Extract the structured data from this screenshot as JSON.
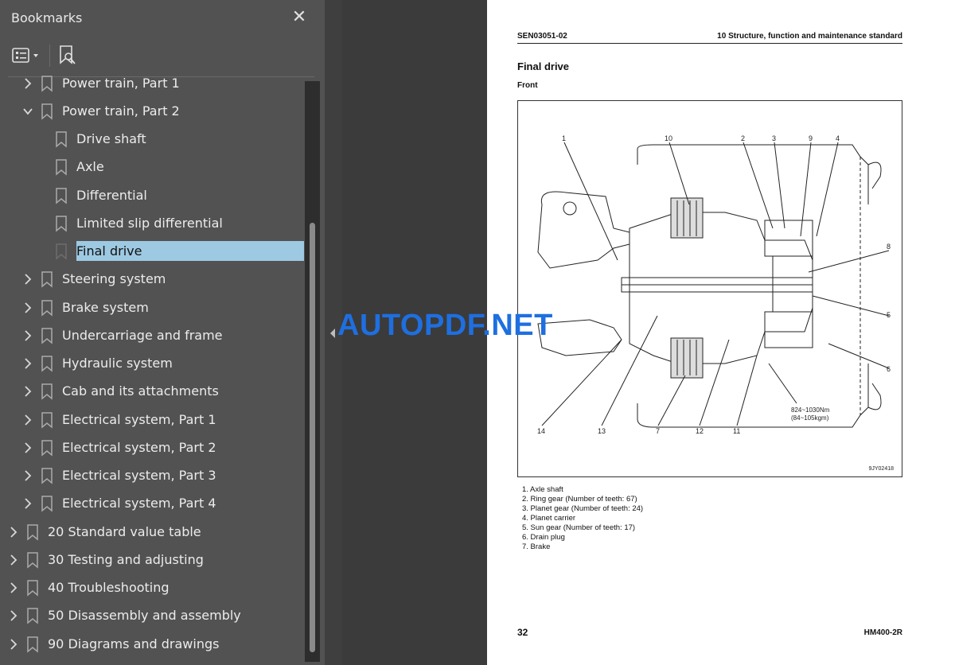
{
  "panel": {
    "title": "Bookmarks",
    "close_glyph": "✕",
    "icons": {
      "close": "close-icon",
      "options": "list-options-icon",
      "find": "bookmark-search-icon"
    }
  },
  "tree": [
    {
      "label": "Power train, Part 1",
      "level": 1,
      "state": "collapsed"
    },
    {
      "label": "Power train, Part 2",
      "level": 1,
      "state": "expanded"
    },
    {
      "label": "Drive shaft",
      "level": 2,
      "state": "leaf"
    },
    {
      "label": "Axle",
      "level": 2,
      "state": "leaf"
    },
    {
      "label": "Differential",
      "level": 2,
      "state": "leaf"
    },
    {
      "label": "Limited slip differential",
      "level": 2,
      "state": "leaf"
    },
    {
      "label": "Final drive",
      "level": 2,
      "state": "leaf",
      "selected": true
    },
    {
      "label": "Steering system",
      "level": 1,
      "state": "collapsed"
    },
    {
      "label": "Brake system",
      "level": 1,
      "state": "collapsed"
    },
    {
      "label": "Undercarriage and frame",
      "level": 1,
      "state": "collapsed"
    },
    {
      "label": "Hydraulic system",
      "level": 1,
      "state": "collapsed"
    },
    {
      "label": "Cab and its attachments",
      "level": 1,
      "state": "collapsed"
    },
    {
      "label": "Electrical system, Part 1",
      "level": 1,
      "state": "collapsed"
    },
    {
      "label": "Electrical system, Part 2",
      "level": 1,
      "state": "collapsed"
    },
    {
      "label": "Electrical system, Part 3",
      "level": 1,
      "state": "collapsed"
    },
    {
      "label": "Electrical system, Part 4",
      "level": 1,
      "state": "collapsed"
    },
    {
      "label": "20 Standard value table",
      "level": 0,
      "state": "collapsed"
    },
    {
      "label": "30 Testing and adjusting",
      "level": 0,
      "state": "collapsed"
    },
    {
      "label": "40 Troubleshooting",
      "level": 0,
      "state": "collapsed"
    },
    {
      "label": "50 Disassembly and assembly",
      "level": 0,
      "state": "collapsed"
    },
    {
      "label": "90 Diagrams and drawings",
      "level": 0,
      "state": "collapsed"
    }
  ],
  "document": {
    "header_code": "SEN03051-02",
    "header_section": "10 Structure, function and maintenance standard",
    "title": "Final drive",
    "subtitle": "Front",
    "figure_code": "9JY02418",
    "torque_label_1": "824~1030Nm",
    "torque_label_2": "(84~105kgm)",
    "callouts": [
      "1",
      "10",
      "2",
      "3",
      "9",
      "4",
      "8",
      "5",
      "6",
      "14",
      "13",
      "7",
      "12",
      "11"
    ],
    "parts": [
      "1. Axle shaft",
      "2. Ring gear (Number of teeth: 67)",
      "3. Planet gear (Number of teeth: 24)",
      "4. Planet carrier",
      "5. Sun gear (Number of teeth: 17)",
      "6. Drain plug",
      "7. Brake"
    ],
    "page_number": "32",
    "model": "HM400-2R"
  },
  "watermark": "AUTOPDF.NET",
  "colors": {
    "panel_bg": "#525252",
    "selection": "#9ec9e2",
    "watermark": "#1e6fe0",
    "viewer_bg": "#3b3b3b"
  }
}
